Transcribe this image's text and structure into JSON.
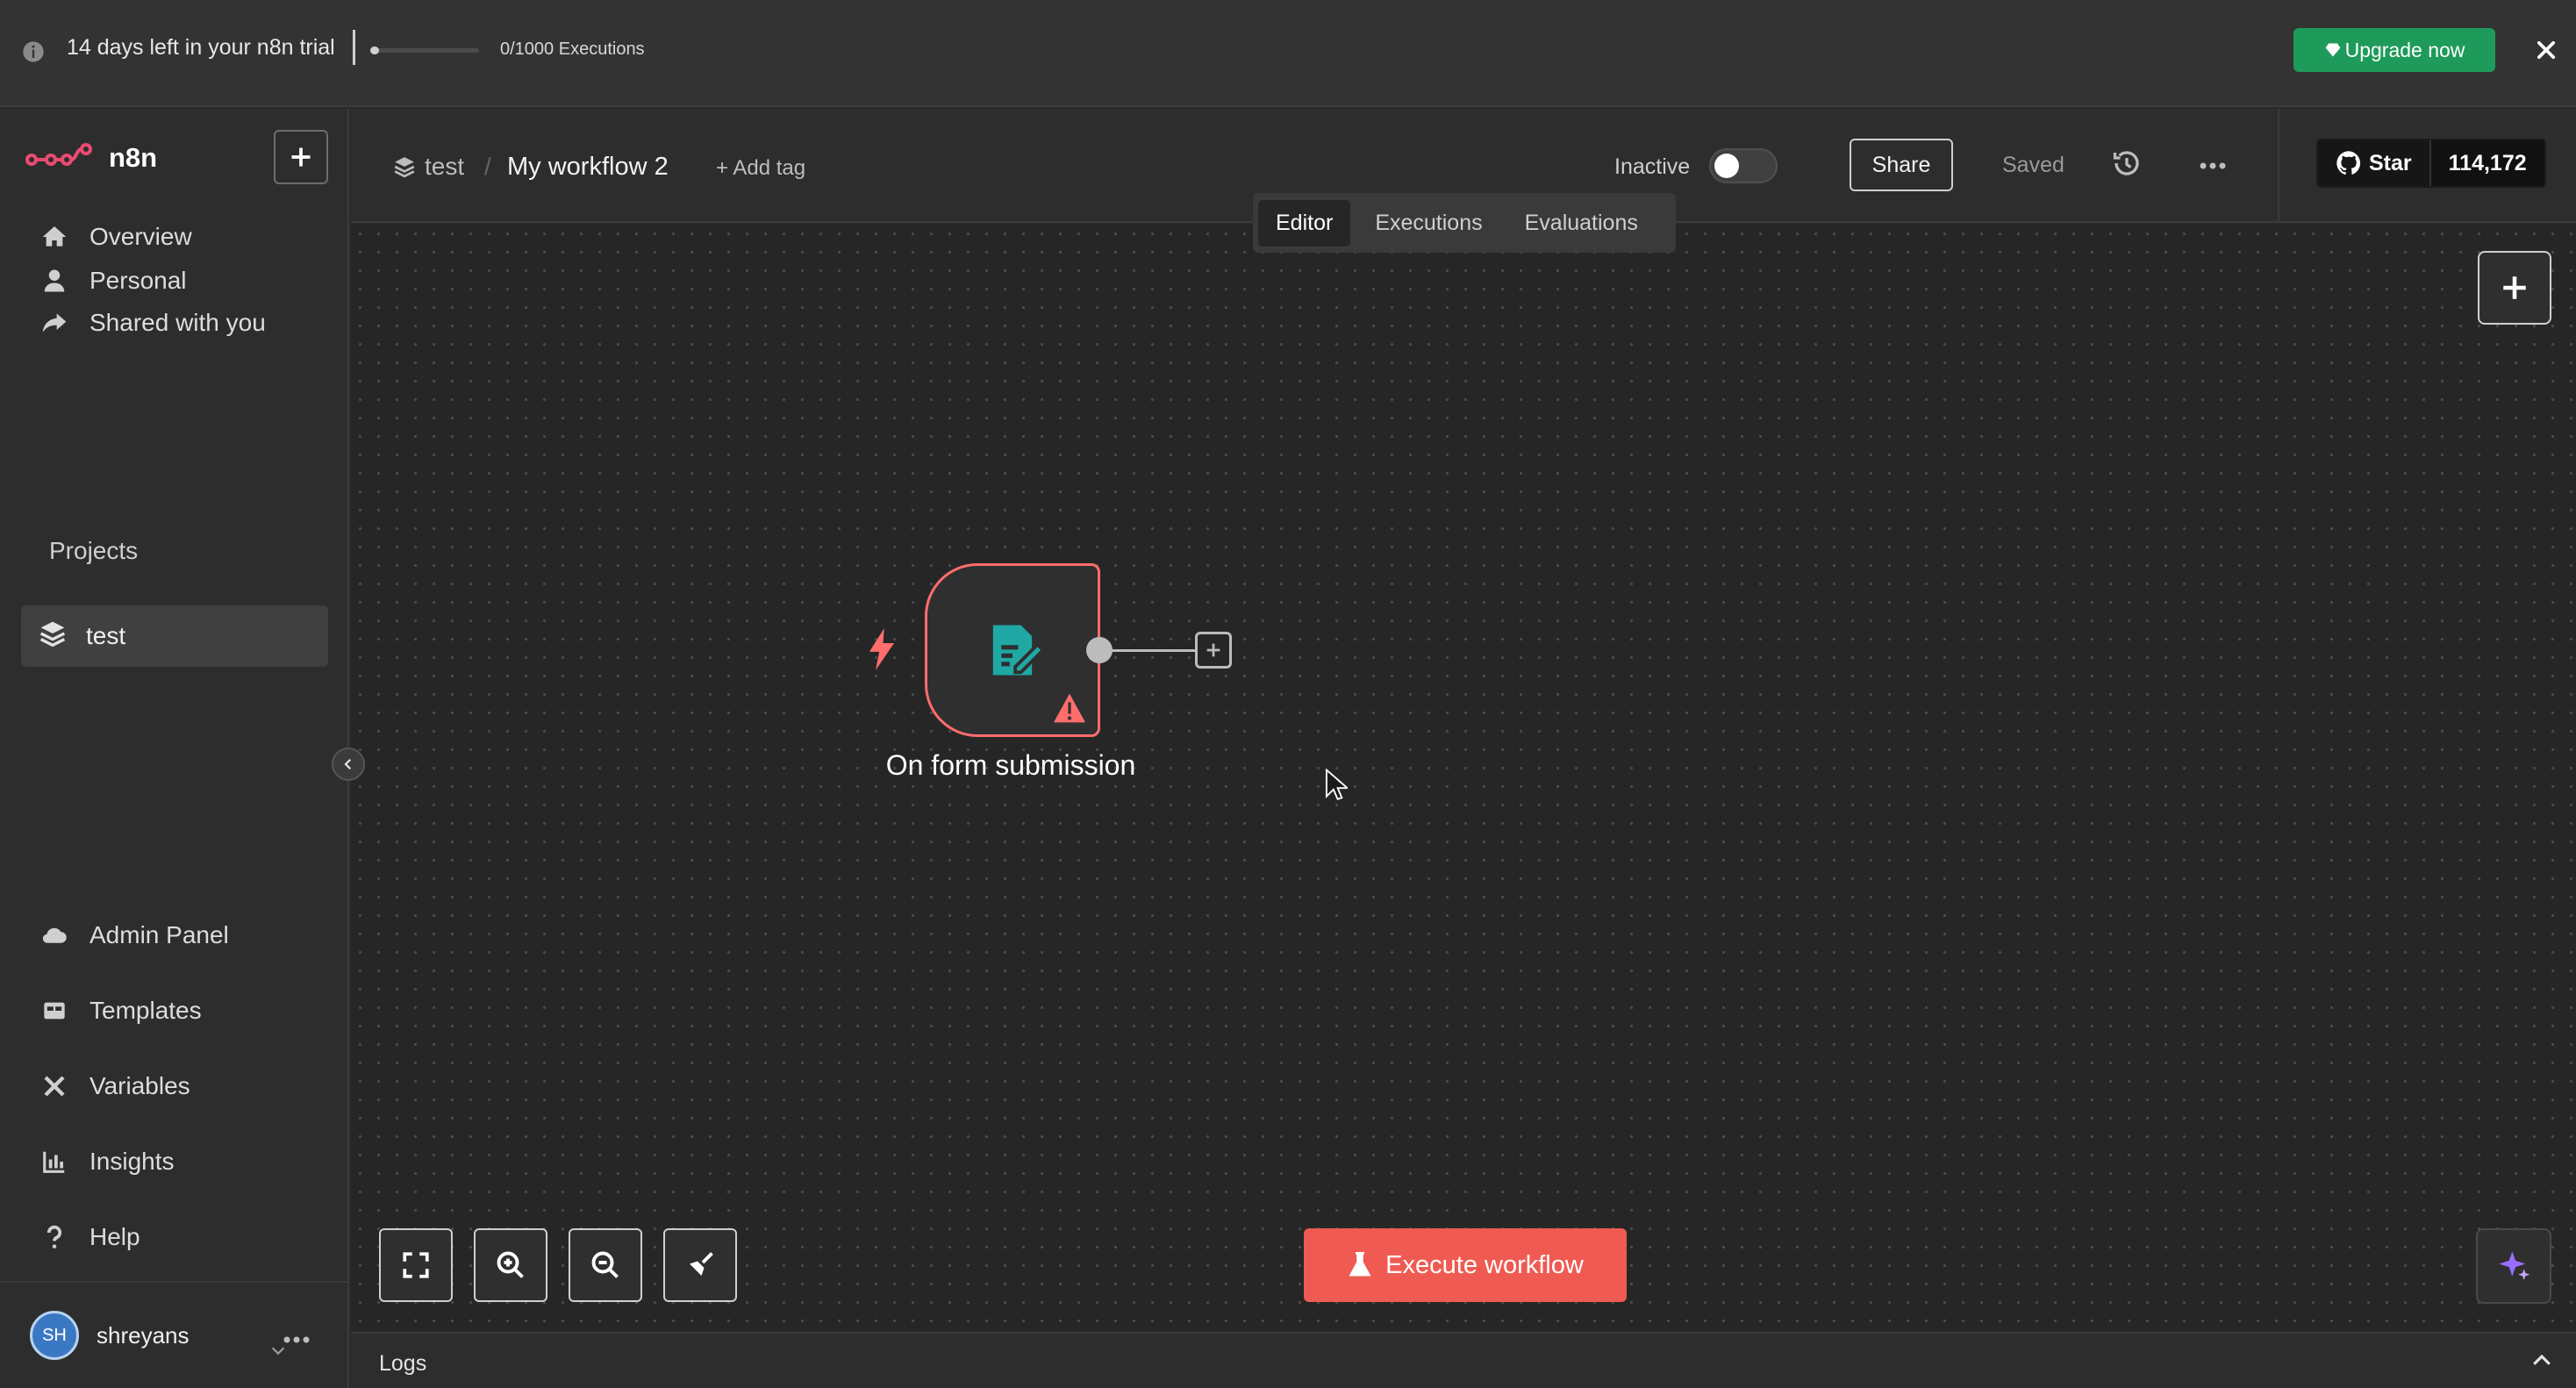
{
  "banner": {
    "trial_text": "14 days left in your n8n trial",
    "executions": "0/1000 Executions",
    "executions_used_fraction": 0.0,
    "upgrade_label": "Upgrade now",
    "upgrade_color": "#1e9b5a"
  },
  "sidebar": {
    "brand": "n8n",
    "nav": [
      {
        "label": "Overview",
        "icon": "home-icon"
      },
      {
        "label": "Personal",
        "icon": "user-icon"
      },
      {
        "label": "Shared with you",
        "icon": "share-icon"
      }
    ],
    "projects_heading": "Projects",
    "projects": [
      {
        "label": "test",
        "icon": "layers-icon"
      }
    ],
    "bottom_nav": [
      {
        "label": "Admin Panel",
        "icon": "cloud-icon"
      },
      {
        "label": "Templates",
        "icon": "templates-icon"
      },
      {
        "label": "Variables",
        "icon": "variables-icon"
      },
      {
        "label": "Insights",
        "icon": "chart-icon"
      },
      {
        "label": "Help",
        "icon": "question-icon"
      }
    ],
    "user": {
      "initials": "SH",
      "name": "shreyans"
    }
  },
  "header": {
    "project": "test",
    "workflow_name": "My workflow 2",
    "add_tag": "+ Add tag",
    "active_label": "Inactive",
    "active": false,
    "share_label": "Share",
    "save_status": "Saved",
    "github": {
      "star_label": "Star",
      "star_count": "114,172"
    }
  },
  "tabs": [
    {
      "label": "Editor",
      "active": true
    },
    {
      "label": "Executions",
      "active": false
    },
    {
      "label": "Evaluations",
      "active": false
    }
  ],
  "canvas": {
    "node": {
      "label": "On form submission",
      "icon": "form-edit-icon",
      "has_warning": true,
      "trigger": true,
      "border_color": "#ff6d6d",
      "icon_color": "#1fa8a4"
    },
    "execute_label": "Execute workflow",
    "execute_color": "#ef5b52"
  },
  "logs": {
    "label": "Logs"
  }
}
